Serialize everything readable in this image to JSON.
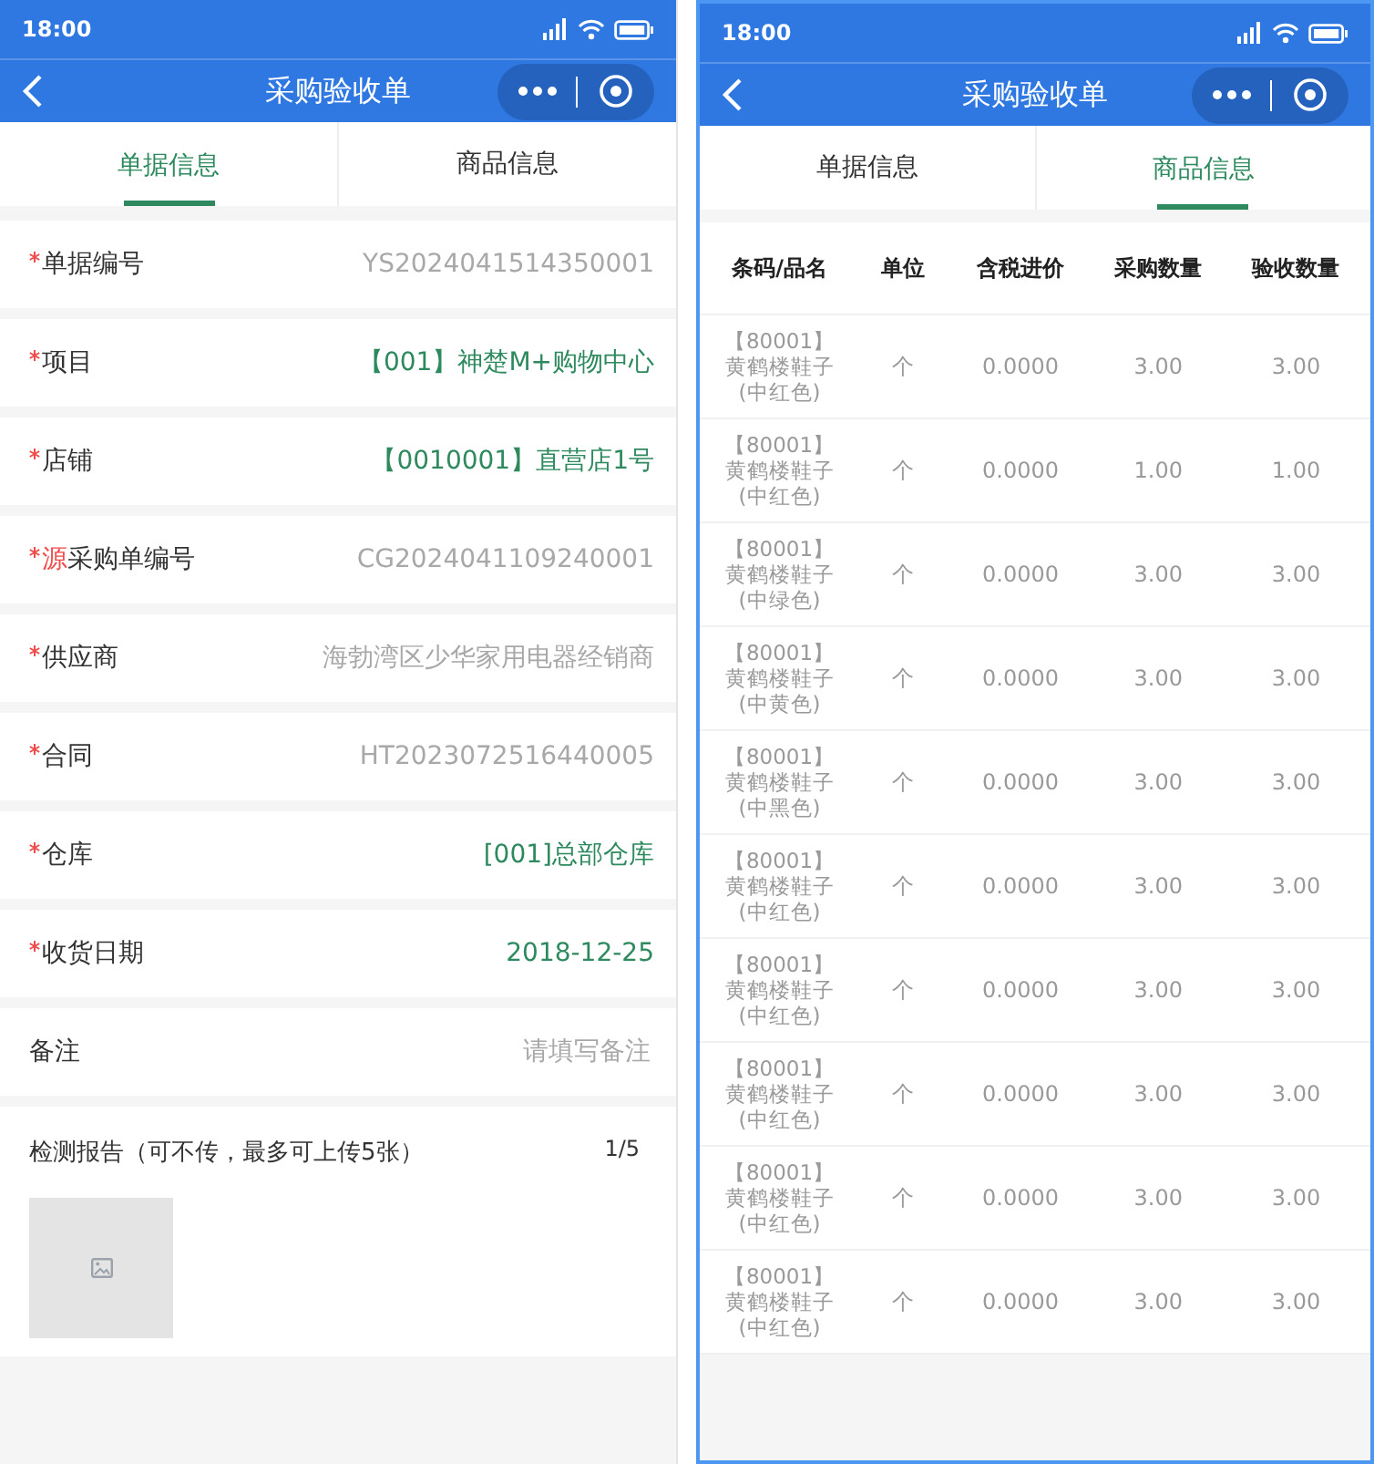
{
  "screens": [
    {
      "kind": "form",
      "status_bar": {
        "time": "18:00"
      },
      "nav": {
        "title": "采购验收单"
      },
      "tabs": [
        {
          "label": "单据信息",
          "selected": true
        },
        {
          "label": "商品信息",
          "selected": false
        }
      ],
      "fields": [
        {
          "kind": "text",
          "label": "单据编号",
          "required": true,
          "value": "YS2024041514350001"
        },
        {
          "kind": "picker",
          "label": "项目",
          "required": true,
          "value": "【001】神楚M+购物中心"
        },
        {
          "kind": "picker",
          "label": "店铺",
          "required": true,
          "value": "【0010001】直营店1号"
        },
        {
          "kind": "text",
          "label_prefix": "源",
          "label": "采购单编号",
          "required": true,
          "value": "CG2024041109240001"
        },
        {
          "kind": "text",
          "label": "供应商",
          "required": true,
          "value": "海勃湾区少华家用电器经销商"
        },
        {
          "kind": "text",
          "label": "合同",
          "required": true,
          "value": "HT2023072516440005"
        },
        {
          "kind": "picker",
          "label": "仓库",
          "required": true,
          "value": "[001]总部仓库"
        },
        {
          "kind": "picker",
          "label": "收货日期",
          "required": true,
          "value": "2018-12-25"
        },
        {
          "kind": "input",
          "label": "备注",
          "required": false,
          "placeholder": "请填写备注"
        }
      ],
      "upload": {
        "label": "检测报告（可不传，最多可上传5张）",
        "count": "1/5"
      }
    },
    {
      "kind": "table",
      "status_bar": {
        "time": "18:00"
      },
      "nav": {
        "title": "采购验收单"
      },
      "tabs": [
        {
          "label": "单据信息",
          "selected": false
        },
        {
          "label": "商品信息",
          "selected": true
        }
      ],
      "table": {
        "columns": [
          "条码/品名",
          "单位",
          "含税进价",
          "采购数量",
          "验收数量"
        ],
        "rows": [
          {
            "product": {
              "code": "【80001】",
              "name": "黄鹤楼鞋子",
              "spec": "(中红色)"
            },
            "unit": "个",
            "price": "0.0000",
            "purchase_qty": "3.00",
            "accepted_qty": "3.00"
          },
          {
            "product": {
              "code": "【80001】",
              "name": "黄鹤楼鞋子",
              "spec": "(中红色)"
            },
            "unit": "个",
            "price": "0.0000",
            "purchase_qty": "1.00",
            "accepted_qty": "1.00"
          },
          {
            "product": {
              "code": "【80001】",
              "name": "黄鹤楼鞋子",
              "spec": "(中绿色)"
            },
            "unit": "个",
            "price": "0.0000",
            "purchase_qty": "3.00",
            "accepted_qty": "3.00"
          },
          {
            "product": {
              "code": "【80001】",
              "name": "黄鹤楼鞋子",
              "spec": "(中黄色)"
            },
            "unit": "个",
            "price": "0.0000",
            "purchase_qty": "3.00",
            "accepted_qty": "3.00"
          },
          {
            "product": {
              "code": "【80001】",
              "name": "黄鹤楼鞋子",
              "spec": "(中黑色)"
            },
            "unit": "个",
            "price": "0.0000",
            "purchase_qty": "3.00",
            "accepted_qty": "3.00"
          },
          {
            "product": {
              "code": "【80001】",
              "name": "黄鹤楼鞋子",
              "spec": "(中红色)"
            },
            "unit": "个",
            "price": "0.0000",
            "purchase_qty": "3.00",
            "accepted_qty": "3.00"
          },
          {
            "product": {
              "code": "【80001】",
              "name": "黄鹤楼鞋子",
              "spec": "(中红色)"
            },
            "unit": "个",
            "price": "0.0000",
            "purchase_qty": "3.00",
            "accepted_qty": "3.00"
          },
          {
            "product": {
              "code": "【80001】",
              "name": "黄鹤楼鞋子",
              "spec": "(中红色)"
            },
            "unit": "个",
            "price": "0.0000",
            "purchase_qty": "3.00",
            "accepted_qty": "3.00"
          },
          {
            "product": {
              "code": "【80001】",
              "name": "黄鹤楼鞋子",
              "spec": "(中红色)"
            },
            "unit": "个",
            "price": "0.0000",
            "purchase_qty": "3.00",
            "accepted_qty": "3.00"
          },
          {
            "product": {
              "code": "【80001】",
              "name": "黄鹤楼鞋子",
              "spec": "(中红色)"
            },
            "unit": "个",
            "price": "0.0000",
            "purchase_qty": "3.00",
            "accepted_qty": "3.00"
          }
        ]
      }
    }
  ]
}
